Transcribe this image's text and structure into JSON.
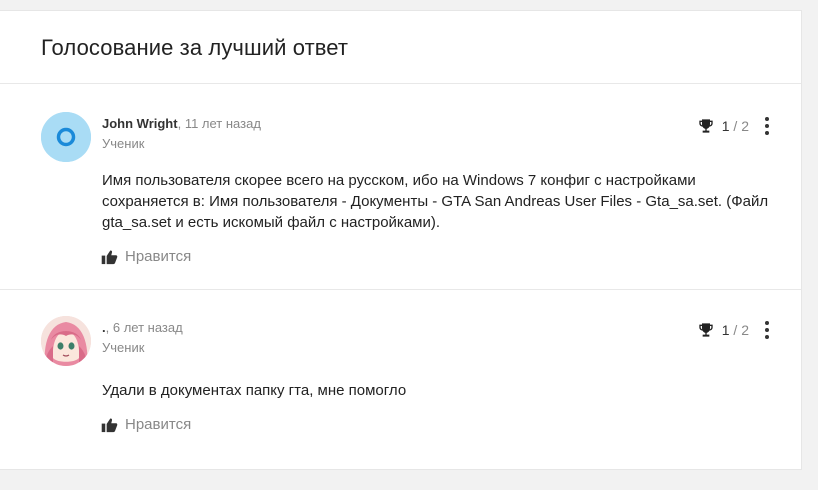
{
  "card": {
    "title": "Голосование за лучший ответ"
  },
  "answers": [
    {
      "author": "John Wright",
      "time": ", 11 лет назад",
      "role": "Ученик",
      "text": "Имя пользователя скорее всего на русском, ибо на Windows 7 конфиг с настройками сохраняется в: Имя пользователя - Документы - GTA San Andreas User Files - Gta_sa.set. (Файл gta_sa.set и есть искомый файл с настройками).",
      "like_label": "Нравится",
      "vote_current": "1",
      "vote_sep": " / ",
      "vote_total": "2",
      "avatar_color": "#a9dcf5"
    },
    {
      "author": ".",
      "time": ", 6 лет назад",
      "role": "Ученик",
      "text": "Удали в документах папку гта, мне помогло",
      "like_label": "Нравится",
      "vote_current": "1",
      "vote_sep": " / ",
      "vote_total": "2",
      "avatar_color": "#f3d9d5"
    }
  ],
  "icons": {
    "trophy": "trophy-icon",
    "thumb": "thumbs-up-icon",
    "more": "more-vertical-icon"
  }
}
